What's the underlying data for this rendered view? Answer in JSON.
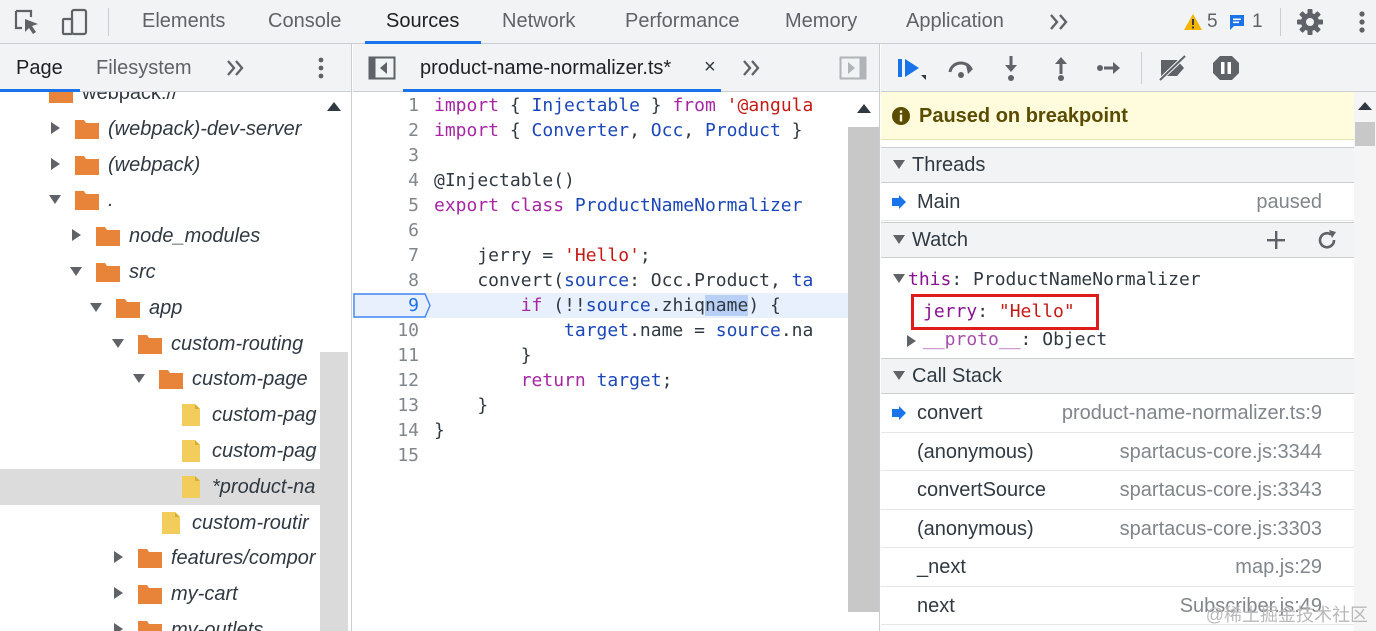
{
  "toolbar": {
    "icons": [
      "inspect-element-icon",
      "device-toolbar-icon",
      "more-tabs-icon",
      "settings-icon",
      "more-options-icon"
    ],
    "tabs": [
      "Elements",
      "Console",
      "Sources",
      "Network",
      "Performance",
      "Memory",
      "Application"
    ],
    "active_tab": "Sources",
    "warnings_count": "5",
    "messages_count": "1",
    "accent_color": "#1a73e8"
  },
  "navigator": {
    "tabs": [
      "Page",
      "Filesystem"
    ],
    "active_tab": "Page",
    "tree": [
      {
        "label": "webpack://",
        "kind": "folder"
      },
      {
        "label": "(webpack)-dev-server",
        "kind": "folder",
        "expanded": false
      },
      {
        "label": "(webpack)",
        "kind": "folder",
        "expanded": false
      },
      {
        "label": ".",
        "kind": "folder",
        "expanded": true
      },
      {
        "label": "node_modules",
        "kind": "folder",
        "expanded": false
      },
      {
        "label": "src",
        "kind": "folder",
        "expanded": true
      },
      {
        "label": "app",
        "kind": "folder",
        "expanded": true
      },
      {
        "label": "custom-routing",
        "kind": "folder",
        "expanded": true
      },
      {
        "label": "custom-page",
        "kind": "folder",
        "expanded": true
      },
      {
        "label": "custom-pag",
        "kind": "file"
      },
      {
        "label": "custom-pag",
        "kind": "file"
      },
      {
        "label": "*product-na",
        "kind": "file",
        "selected": true
      },
      {
        "label": "custom-routir",
        "kind": "file"
      },
      {
        "label": "features/compor",
        "kind": "folder",
        "expanded": false
      },
      {
        "label": "my-cart",
        "kind": "folder",
        "expanded": false
      },
      {
        "label": "my-outlets",
        "kind": "folder",
        "expanded": false
      }
    ]
  },
  "editor": {
    "tab_name": "product-name-normalizer.ts*",
    "close_glyph": "×",
    "breakpoint_line": 9,
    "lines": [
      {
        "n": "1",
        "html": "<span class=\"kw\">import</span> { <span class=\"ty\">Injectable</span> } <span class=\"kw\">from</span> <span class=\"st\">'@angula</span>"
      },
      {
        "n": "2",
        "html": "<span class=\"kw\">import</span> { <span class=\"ty\">Converter</span>, <span class=\"ty\">Occ</span>, <span class=\"ty\">Product</span> }"
      },
      {
        "n": "3",
        "html": ""
      },
      {
        "n": "4",
        "html": "@Injectable()"
      },
      {
        "n": "5",
        "html": "<span class=\"kw\">export</span> <span class=\"kw\">class</span> <span class=\"ty\">ProductNameNormalizer</span>"
      },
      {
        "n": "6",
        "html": ""
      },
      {
        "n": "7",
        "html": "    jerry = <span class=\"st\">'Hello'</span>;"
      },
      {
        "n": "8",
        "html": "    convert(<span class=\"pr\">source</span>: Occ.Product, <span class=\"pr\">ta</span>"
      },
      {
        "n": "9",
        "html": "        <span class=\"kw\">if</span> (!!<span class=\"pr\">source</span>.zhiq<span class=\"hl\">name</span>) {"
      },
      {
        "n": "10",
        "html": "            <span class=\"pr\">target</span>.name = <span class=\"pr\">source</span>.na"
      },
      {
        "n": "11",
        "html": "        }"
      },
      {
        "n": "12",
        "html": "        <span class=\"kw\">return</span> <span class=\"pr\">target</span>;"
      },
      {
        "n": "13",
        "html": "    }"
      },
      {
        "n": "14",
        "html": "}"
      },
      {
        "n": "15",
        "html": ""
      }
    ]
  },
  "debugger": {
    "paused_message": "Paused on breakpoint",
    "sections": {
      "threads": "Threads",
      "watch": "Watch",
      "call_stack": "Call Stack"
    },
    "threads": [
      {
        "name": "Main",
        "status": "paused"
      }
    ],
    "watch": {
      "root_key": "this",
      "root_value": "ProductNameNormalizer",
      "prop_key": "jerry",
      "prop_value": "\"Hello\"",
      "proto_key": "__proto__",
      "proto_value": "Object"
    },
    "call_stack": [
      {
        "name": "convert",
        "loc": "product-name-normalizer.ts:9",
        "current": true
      },
      {
        "name": "(anonymous)",
        "loc": "spartacus-core.js:3344"
      },
      {
        "name": "convertSource",
        "loc": "spartacus-core.js:3343"
      },
      {
        "name": "(anonymous)",
        "loc": "spartacus-core.js:3303"
      },
      {
        "name": "_next",
        "loc": "map.js:29"
      },
      {
        "name": "next",
        "loc": "Subscriber.js:49"
      }
    ],
    "watermark": "@稀土掘金技术社区"
  }
}
